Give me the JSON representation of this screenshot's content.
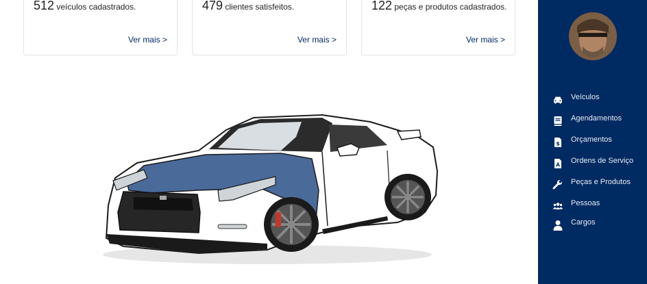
{
  "cards": [
    {
      "count": "512",
      "text": " veículos cadastrados.",
      "link": "Ver mais >"
    },
    {
      "count": "479",
      "text": " clientes satisfeitos.",
      "link": "Ver mais >"
    },
    {
      "count": "122",
      "text": " peças e produtos cadastrados.",
      "link": "Ver mais >"
    }
  ],
  "sidebar": {
    "items": [
      {
        "label": "Veículos",
        "icon": "car-icon"
      },
      {
        "label": "Agendamentos",
        "icon": "book-icon"
      },
      {
        "label": "Orçamentos",
        "icon": "invoice-dollar-icon"
      },
      {
        "label": "Ordens de Serviço",
        "icon": "pdf-file-icon"
      },
      {
        "label": "Peças e Produtos",
        "icon": "wrench-icon"
      },
      {
        "label": "Pessoas",
        "icon": "users-icon"
      },
      {
        "label": "Cargos",
        "icon": "user-icon"
      }
    ]
  },
  "colors": {
    "sidebar": "#002a62",
    "link": "#002a62",
    "highlight": "#4a6a9a"
  }
}
